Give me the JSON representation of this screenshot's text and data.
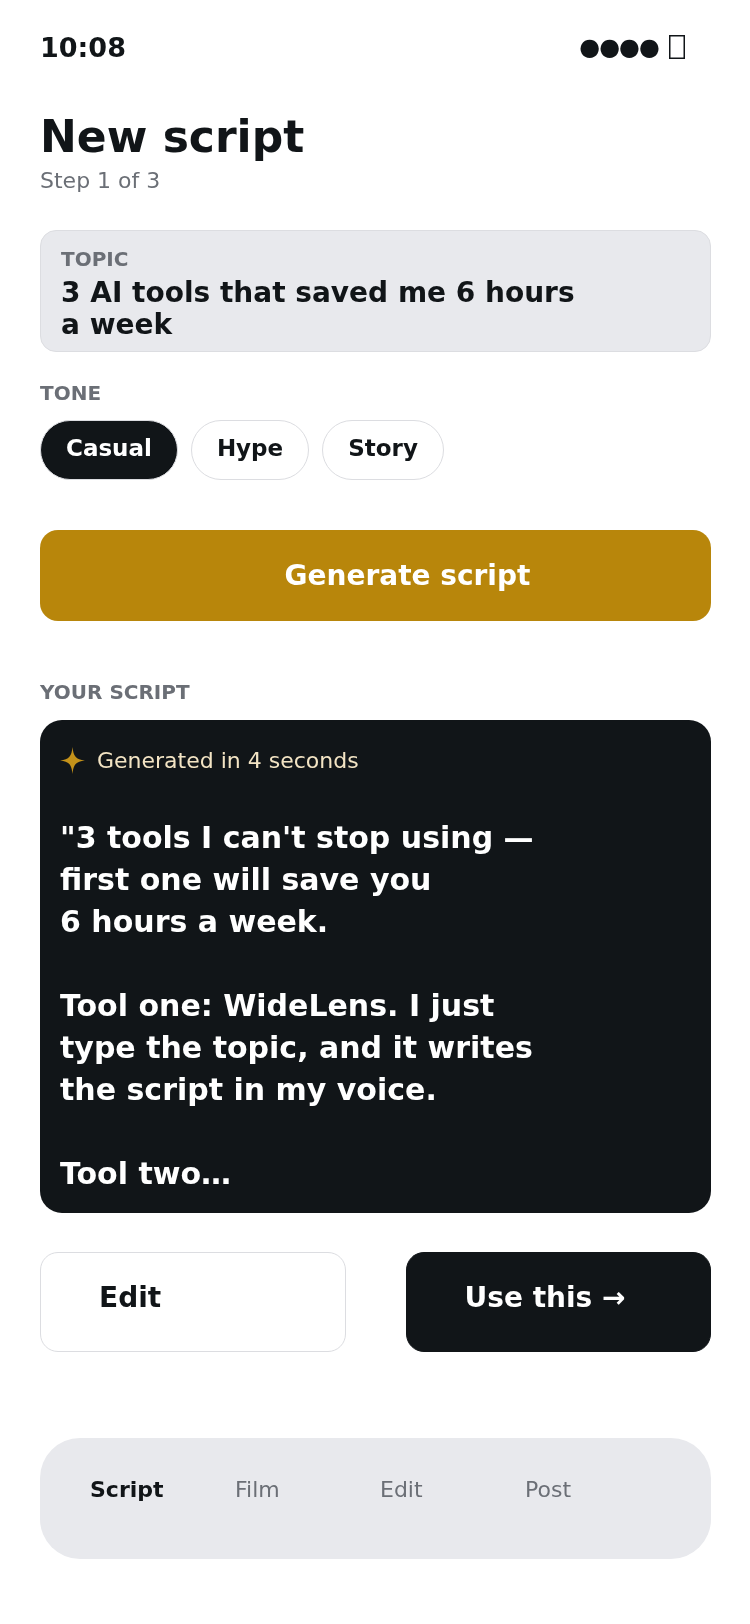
{
  "status_bar": {
    "time": "10:08",
    "signal": "●●●●"
  },
  "header": {
    "title": "New script",
    "step": "Step 1 of 3"
  },
  "topic": {
    "label": "TOPIC",
    "value": "3 AI tools that saved me 6 hours a week"
  },
  "tone": {
    "label": "TONE",
    "options": [
      {
        "label": "Casual",
        "selected": true
      },
      {
        "label": "Hype",
        "selected": false
      },
      {
        "label": "Story",
        "selected": false
      }
    ]
  },
  "generate_button": "Generate script",
  "script": {
    "label": "YOUR SCRIPT",
    "status": "Generated in 4 seconds",
    "text": "\"3 tools I can't stop using —\nfirst one will save you\n6 hours a week.\n\nTool one: WideLens. I just\ntype the topic, and it writes\nthe script in my voice.\n\nTool two…"
  },
  "actions": [
    {
      "label": "Edit",
      "kind": "secondary"
    },
    {
      "label": "Use this →",
      "kind": "primary"
    }
  ],
  "tabs": [
    {
      "label": "Script",
      "selected": true
    },
    {
      "label": "Film",
      "selected": false
    },
    {
      "label": "Edit",
      "selected": false
    },
    {
      "label": "Post",
      "selected": false
    }
  ]
}
